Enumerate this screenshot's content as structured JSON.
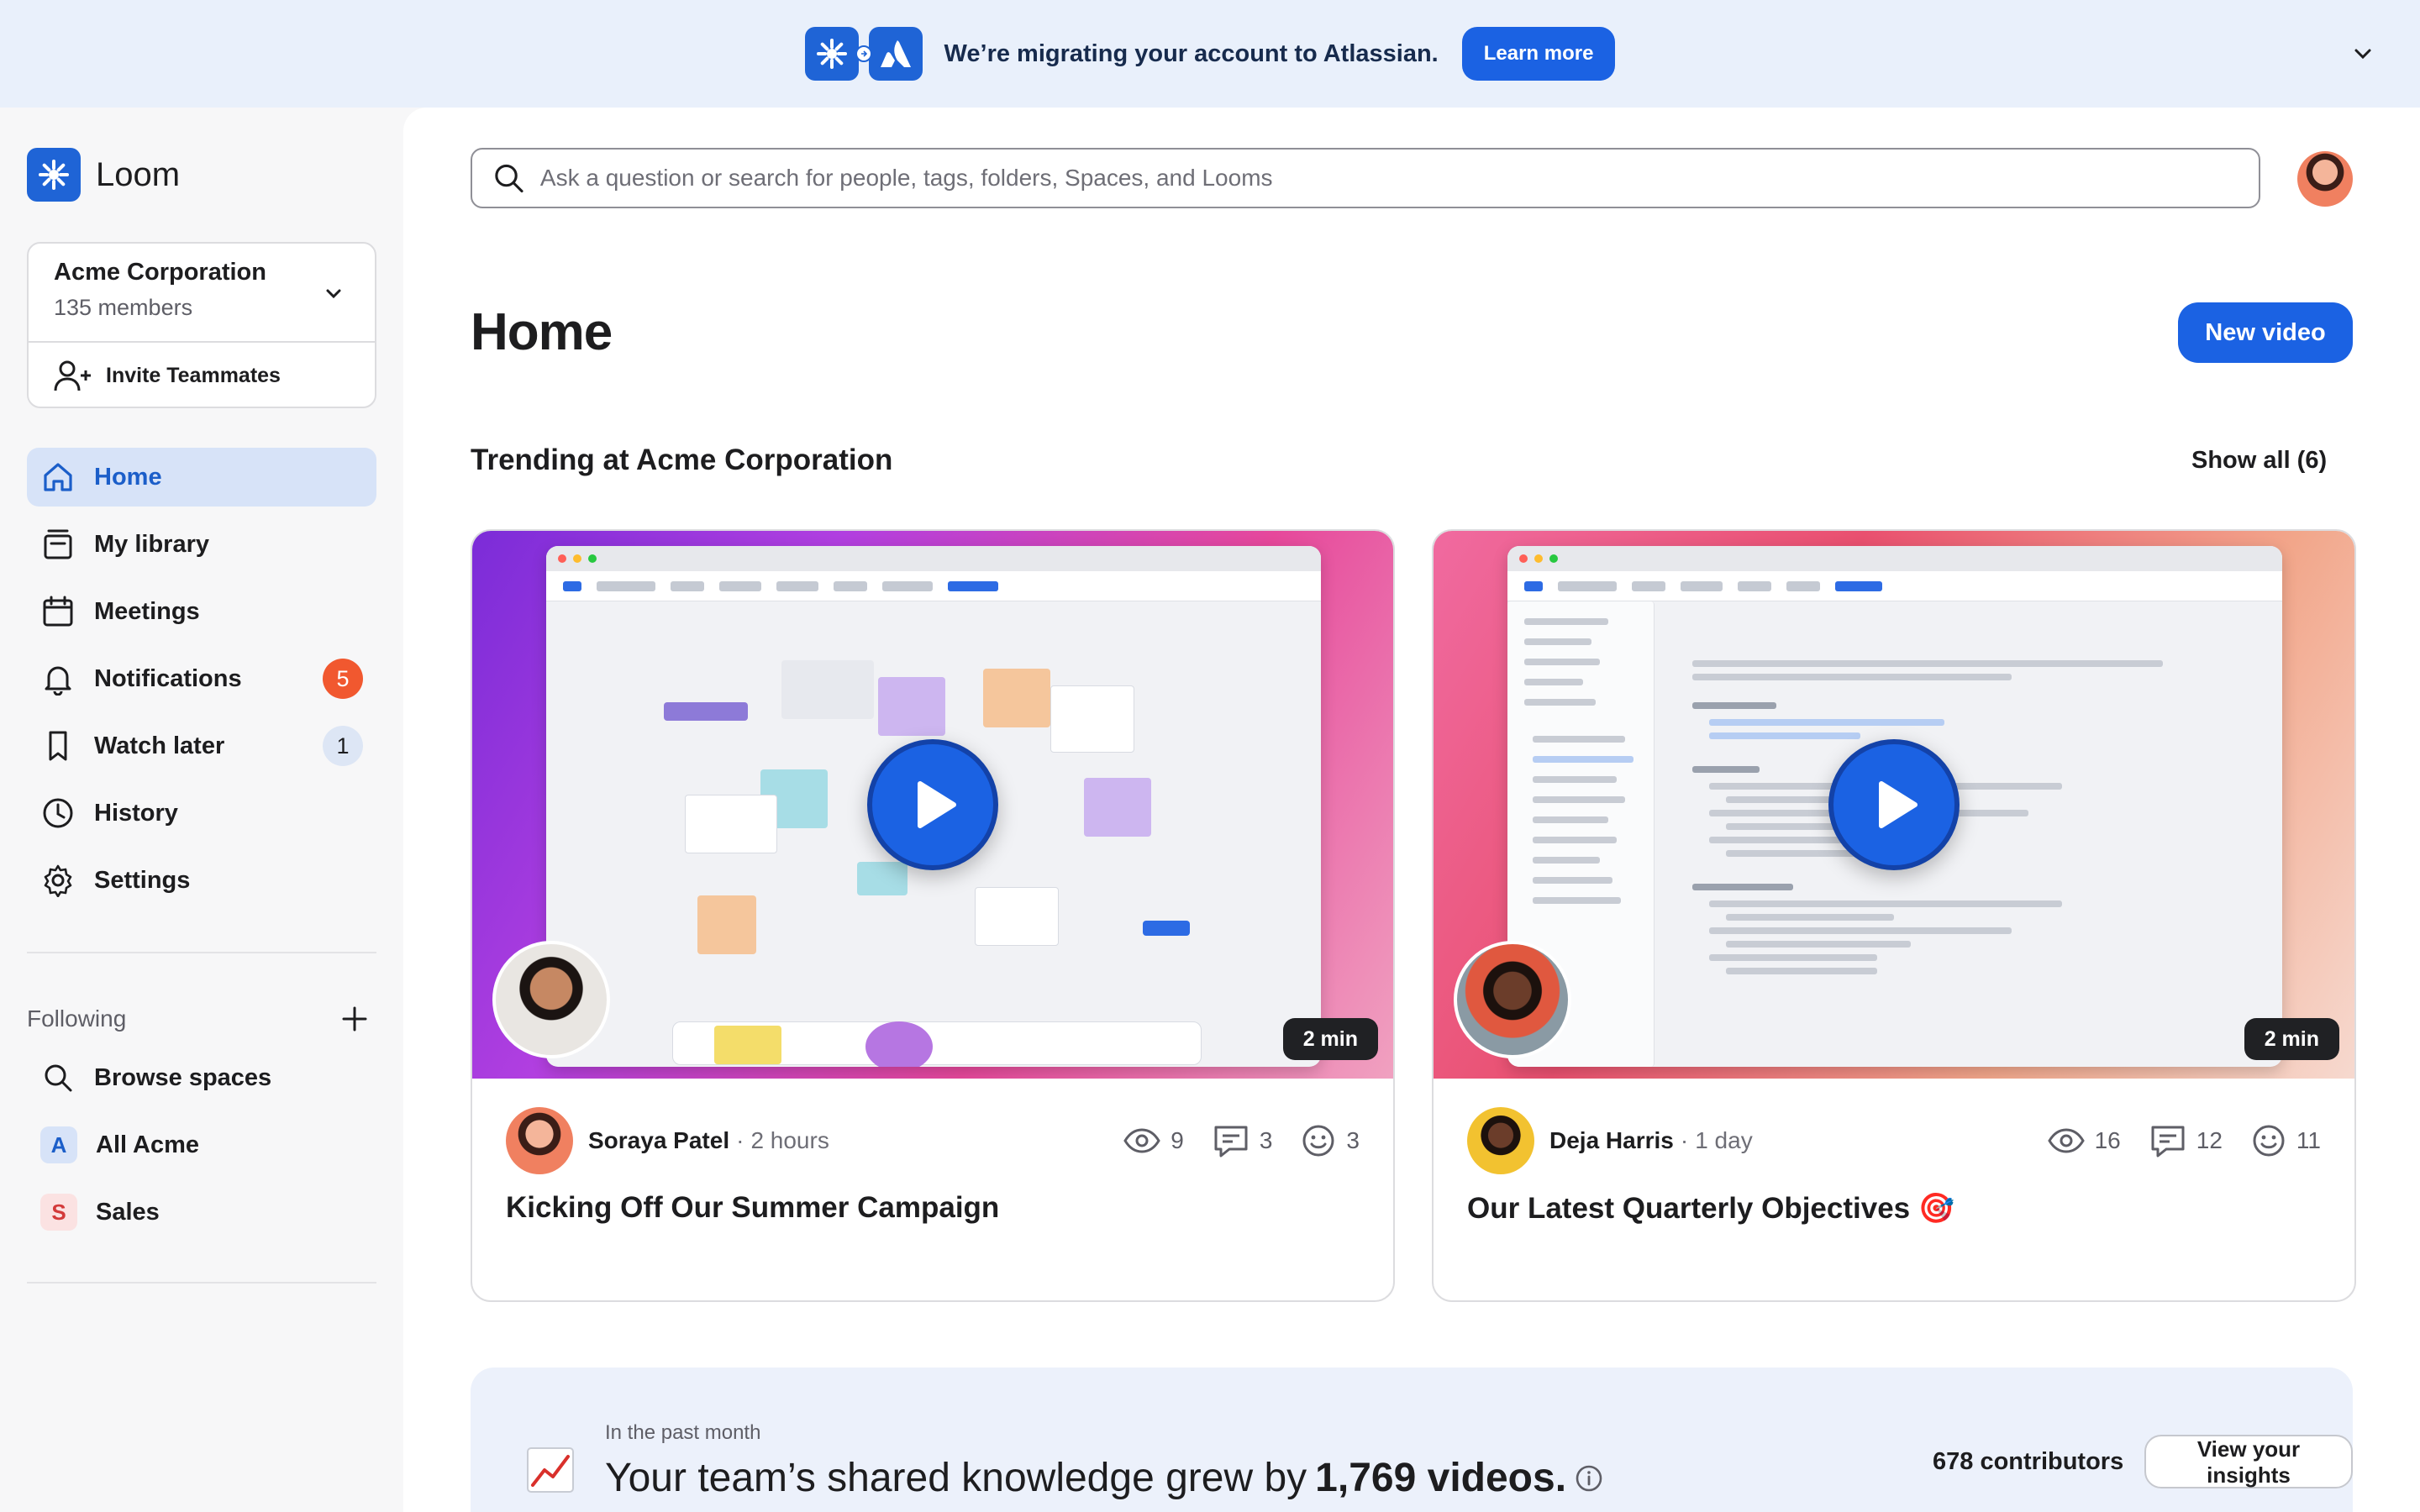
{
  "banner": {
    "message": "We’re migrating your account to Atlassian.",
    "learn_more": "Learn more"
  },
  "brand": {
    "name": "Loom"
  },
  "workspace": {
    "name": "Acme Corporation",
    "members": "135 members",
    "invite": "Invite Teammates"
  },
  "nav": {
    "items": [
      {
        "label": "Home",
        "icon": "home-icon",
        "active": true
      },
      {
        "label": "My library",
        "icon": "library-icon"
      },
      {
        "label": "Meetings",
        "icon": "calendar-icon"
      },
      {
        "label": "Notifications",
        "icon": "bell-icon",
        "badge": "5"
      },
      {
        "label": "Watch later",
        "icon": "bookmark-icon",
        "badge": "1"
      },
      {
        "label": "History",
        "icon": "clock-icon"
      },
      {
        "label": "Settings",
        "icon": "gear-icon"
      }
    ]
  },
  "following": {
    "label": "Following",
    "items": [
      {
        "label": "Browse spaces",
        "icon": "search-icon"
      },
      {
        "label": "All Acme",
        "letter": "A"
      },
      {
        "label": "Sales",
        "letter": "S"
      }
    ]
  },
  "search": {
    "placeholder": "Ask a question or search for people, tags, folders, Spaces, and Looms"
  },
  "page": {
    "title": "Home",
    "new_video": "New video"
  },
  "trending": {
    "title": "Trending at Acme Corporation",
    "show_all": "Show all (6)",
    "cards": [
      {
        "author": "Soraya Patel",
        "ago": "2 hours",
        "views": "9",
        "comments": "3",
        "reactions": "3",
        "duration": "2 min",
        "title": "Kicking Off Our Summer Campaign"
      },
      {
        "author": "Deja Harris",
        "ago": "1 day",
        "views": "16",
        "comments": "12",
        "reactions": "11",
        "duration": "2 min",
        "title": "Our Latest Quarterly Objectives 🎯"
      }
    ]
  },
  "insights": {
    "period": "In the past month",
    "lead": "Your team’s shared knowledge grew by",
    "value": "1,769 videos.",
    "contributors": "678 contributors",
    "button": "View your insights"
  },
  "colors": {
    "brand_blue": "#1b62e3",
    "badge_red": "#f1582f",
    "active_nav_bg": "#d7e3f8"
  }
}
